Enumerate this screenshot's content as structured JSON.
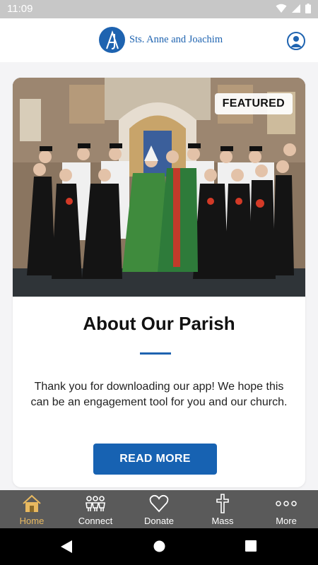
{
  "status_bar": {
    "time": "11:09"
  },
  "header": {
    "logo_text": "Sts. Anne and Joachim"
  },
  "card": {
    "badge": "FEATURED",
    "title": "About Our Parish",
    "body": "Thank you for downloading our app! We hope this can be an engagement tool for you and our church.",
    "button_label": "READ MORE"
  },
  "nav": {
    "items": [
      {
        "label": "Home",
        "icon": "home-icon",
        "active": true
      },
      {
        "label": "Connect",
        "icon": "people-icon",
        "active": false
      },
      {
        "label": "Donate",
        "icon": "heart-icon",
        "active": false
      },
      {
        "label": "Mass",
        "icon": "cross-icon",
        "active": false
      },
      {
        "label": "More",
        "icon": "more-icon",
        "active": false
      }
    ]
  },
  "colors": {
    "brand": "#1e63b0",
    "active_nav": "#e8b960",
    "nav_bg": "#5a5a5a"
  }
}
